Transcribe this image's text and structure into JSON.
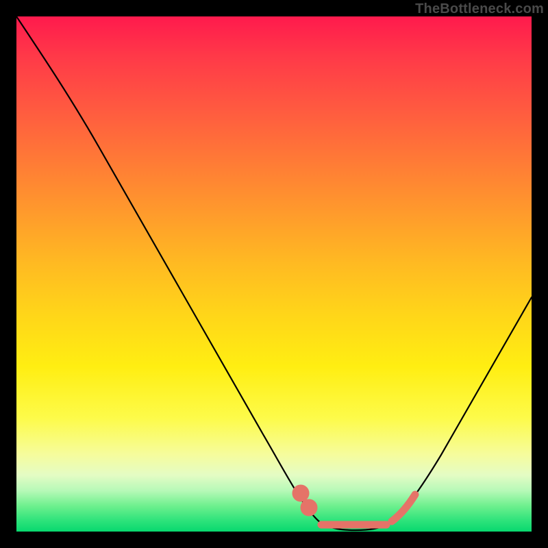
{
  "watermark": {
    "text": "TheBottleneck.com"
  },
  "chart_data": {
    "type": "line",
    "title": "",
    "xlabel": "",
    "ylabel": "",
    "xlim": [
      0,
      100
    ],
    "ylim": [
      0,
      100
    ],
    "grid": false,
    "legend": false,
    "background_gradient": {
      "direction": "vertical",
      "stops": [
        {
          "pos": 0,
          "color": "#ff1a4d"
        },
        {
          "pos": 50,
          "color": "#ffcf1c"
        },
        {
          "pos": 85,
          "color": "#f6fc9c"
        },
        {
          "pos": 100,
          "color": "#08d86f"
        }
      ]
    },
    "series": [
      {
        "name": "bottleneck-curve",
        "color": "#000000",
        "x": [
          0,
          5,
          10,
          15,
          20,
          25,
          30,
          35,
          40,
          45,
          50,
          55,
          58,
          60,
          62,
          65,
          68,
          70,
          72,
          75,
          80,
          85,
          90,
          95,
          100
        ],
        "y": [
          100,
          93,
          86,
          78,
          70,
          62,
          54,
          45,
          36,
          27,
          18,
          10,
          5,
          3,
          1,
          0,
          0,
          0,
          1,
          3,
          9,
          17,
          27,
          38,
          50
        ]
      },
      {
        "name": "minimum-marker",
        "type": "scatter",
        "color": "#e57368",
        "marker_style": "dot+dash",
        "x": [
          55,
          57,
          60,
          63,
          66,
          69,
          72,
          74,
          76
        ],
        "y": [
          5,
          3,
          1,
          0,
          0,
          0,
          1,
          3,
          6
        ]
      }
    ],
    "annotations": []
  }
}
